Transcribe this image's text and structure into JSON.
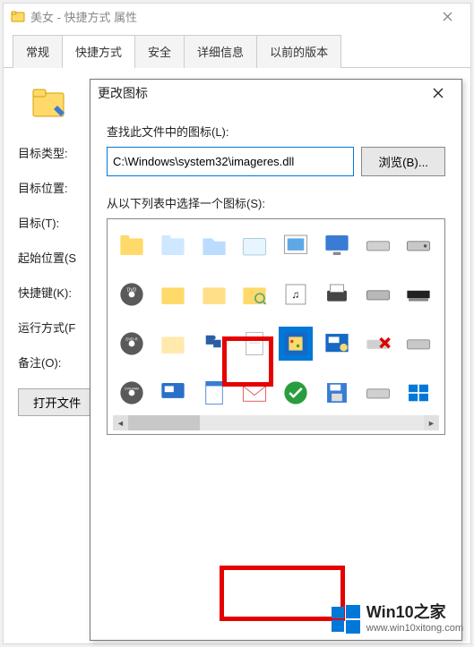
{
  "prop": {
    "title": "美女 - 快捷方式 属性",
    "tabs": [
      "常规",
      "快捷方式",
      "安全",
      "详细信息",
      "以前的版本"
    ],
    "active_tab": 1,
    "labels": {
      "target_type": "目标类型:",
      "target_loc": "目标位置:",
      "target": "目标(T):",
      "start_in": "起始位置(S",
      "shortcut_key": "快捷键(K):",
      "run": "运行方式(F",
      "comment": "备注(O):"
    },
    "open_file_loc": "打开文件"
  },
  "icon_dlg": {
    "title": "更改图标",
    "look_in_label": "查找此文件中的图标(L):",
    "path_value": "C:\\Windows\\system32\\imageres.dll",
    "browse": "浏览(B)...",
    "select_label": "从以下列表中选择一个图标(S):",
    "icons": [
      "folder-icon",
      "folder-front-icon",
      "folder-open-icon",
      "folder-glass-icon",
      "image-icon",
      "monitor-icon",
      "drive-icon",
      "optical-drive-icon",
      "dvd-disc-icon",
      "folder-yellow-icon",
      "folder-yellow2-icon",
      "folder-search-icon",
      "music-icon",
      "printer-icon",
      "drive2-icon",
      "ram-icon",
      "dvdr-disc-icon",
      "folder-plain-icon",
      "puzzle-icon",
      "doc-icon",
      "video-icon",
      "control-item-icon",
      "drive-x-icon",
      "drive3-icon",
      "dvdram-disc-icon",
      "monitor-app-icon",
      "page-icon",
      "mail-icon",
      "checkmark-icon",
      "floppy-icon",
      "drive4-icon",
      "window-icon",
      "dvdrom-disc-icon"
    ],
    "selected_index": 20
  },
  "watermark": {
    "main": "Win10之家",
    "sub": "www.win10xitong.com"
  }
}
